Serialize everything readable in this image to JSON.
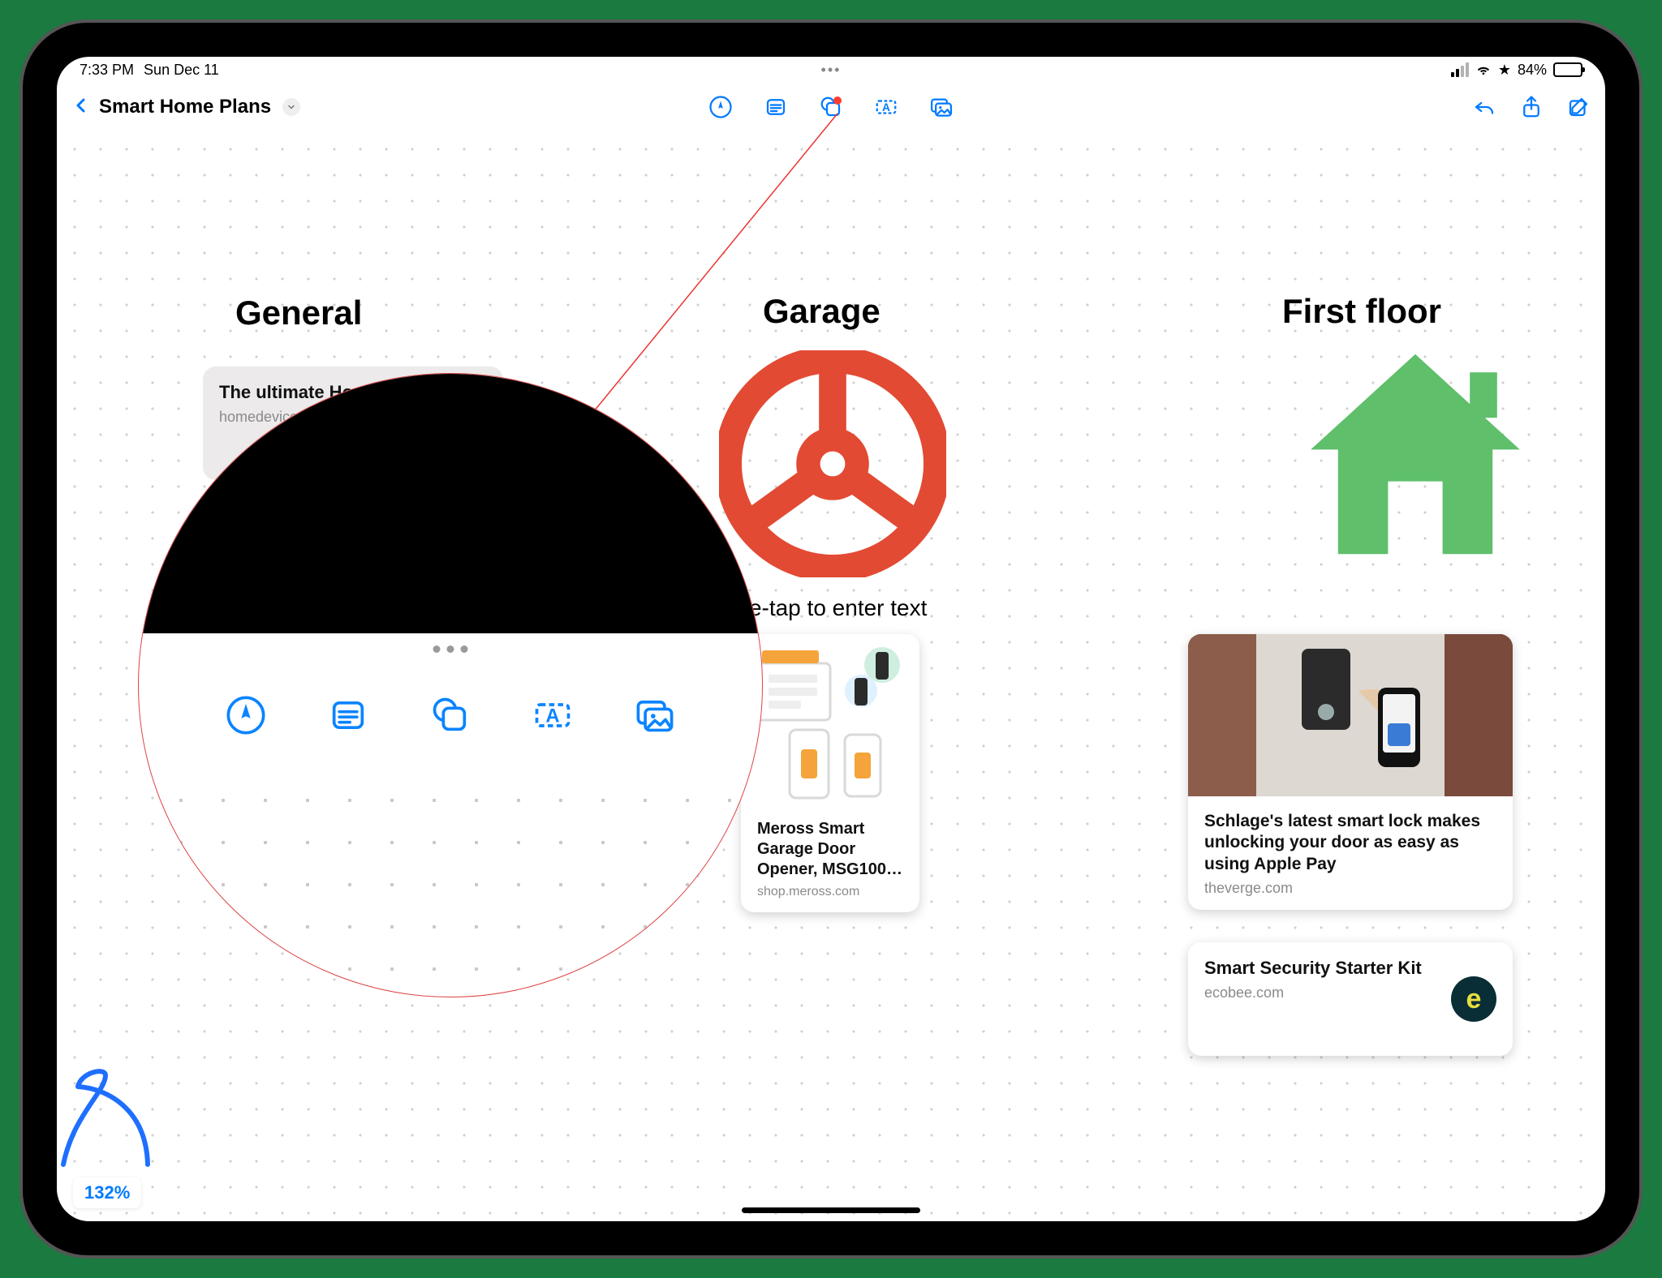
{
  "status": {
    "time": "7:33 PM",
    "date": "Sun Dec 11",
    "battery_text": "84%"
  },
  "toolbar": {
    "doc_title": "Smart Home Plans",
    "tools": [
      "pen",
      "note",
      "shapes",
      "textbox",
      "media"
    ],
    "right": [
      "undo",
      "share",
      "compose"
    ]
  },
  "canvas": {
    "zoom": "132%",
    "placeholder": "ouble-tap to enter text",
    "sections": {
      "general": {
        "title": "General"
      },
      "garage": {
        "title": "Garage"
      },
      "first": {
        "title": "First floor"
      }
    },
    "cards": {
      "homekit": {
        "title": "The ultimate HomeKit database",
        "subtitle": "homedevices.a"
      },
      "meross": {
        "title": "Meross Smart Garage Door Opener, MSG100…",
        "subtitle": "shop.meross.com"
      },
      "schlage": {
        "title": "Schlage's latest smart lock makes unlocking your door as easy as using Apple Pay",
        "subtitle": "theverge.com"
      },
      "ecobee": {
        "title": "Smart Security Starter Kit",
        "subtitle": "ecobee.com",
        "logo": "e"
      }
    }
  },
  "magnifier": {
    "tools": [
      "pen",
      "note",
      "shapes",
      "textbox",
      "media"
    ]
  }
}
